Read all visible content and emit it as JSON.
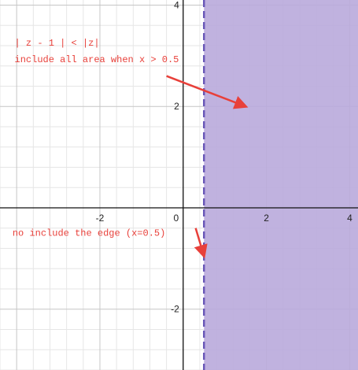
{
  "chart_data": {
    "type": "area",
    "xlim": [
      -4.4,
      4.2
    ],
    "ylim": [
      -3.2,
      4.1
    ],
    "grid": true,
    "x_ticks": [
      {
        "value": -2,
        "label": "-2"
      },
      {
        "value": 0,
        "label": "0"
      },
      {
        "value": 2,
        "label": "2"
      },
      {
        "value": 4,
        "label": "4"
      }
    ],
    "y_ticks": [
      {
        "value": 4,
        "label": "4"
      },
      {
        "value": 2,
        "label": "2"
      },
      {
        "value": -2,
        "label": "-2"
      }
    ],
    "region": {
      "condition": "x > 0.5",
      "boundary_x": 0.5,
      "boundary_style": "dashed",
      "fill_color": "#b9aadb",
      "boundary_color": "#6a58b8"
    },
    "annotations": [
      {
        "lines": [
          "| z - 1 | < |z|",
          "include all area when x > 0.5"
        ],
        "color": "#e8403a",
        "arrow": {
          "from": [
            -0.4,
            2.6
          ],
          "to": [
            1.5,
            2.0
          ]
        }
      },
      {
        "lines": [
          "no include the edge (x=0.5)"
        ],
        "color": "#e8403a",
        "arrow": {
          "from": [
            0.3,
            -0.4
          ],
          "to": [
            0.5,
            -0.95
          ]
        }
      }
    ]
  }
}
